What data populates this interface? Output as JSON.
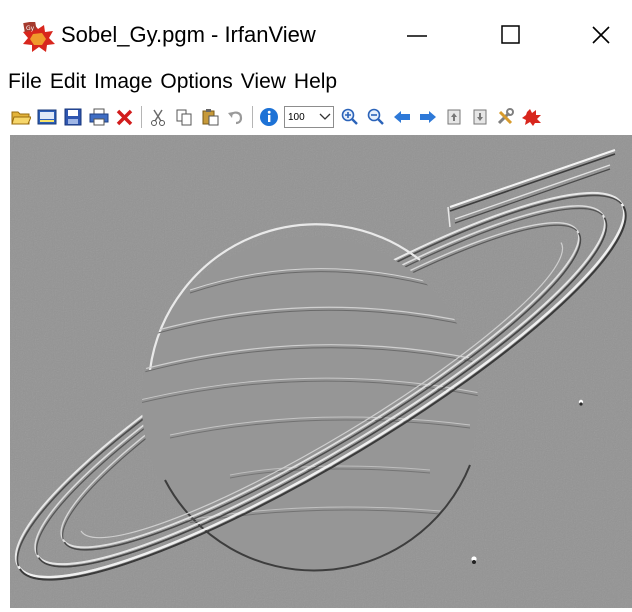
{
  "window": {
    "title": "Sobel_Gy.pgm - IrfanView",
    "controls": {
      "minimize": "—",
      "maximize": "☐",
      "close": "✕"
    }
  },
  "menu": [
    "File",
    "Edit",
    "Image",
    "Options",
    "View",
    "Help"
  ],
  "toolbar": {
    "left_buttons": [
      "open-folder-icon",
      "thumbnails-icon",
      "save-icon",
      "print-icon",
      "delete-icon"
    ],
    "edit_buttons": [
      "cut-icon",
      "copy-icon",
      "paste-icon",
      "undo-icon"
    ],
    "info_button": "info-icon",
    "zoom_value": "100",
    "right_buttons": [
      "zoom-in-icon",
      "zoom-out-icon",
      "previous-icon",
      "next-icon",
      "page-up-icon",
      "page-down-icon",
      "properties-icon",
      "irfanview-icon"
    ]
  },
  "image": {
    "description_colors": {
      "background": "#939393",
      "highlight": "#f2f2f2",
      "shadow": "#3a3a3a"
    }
  }
}
